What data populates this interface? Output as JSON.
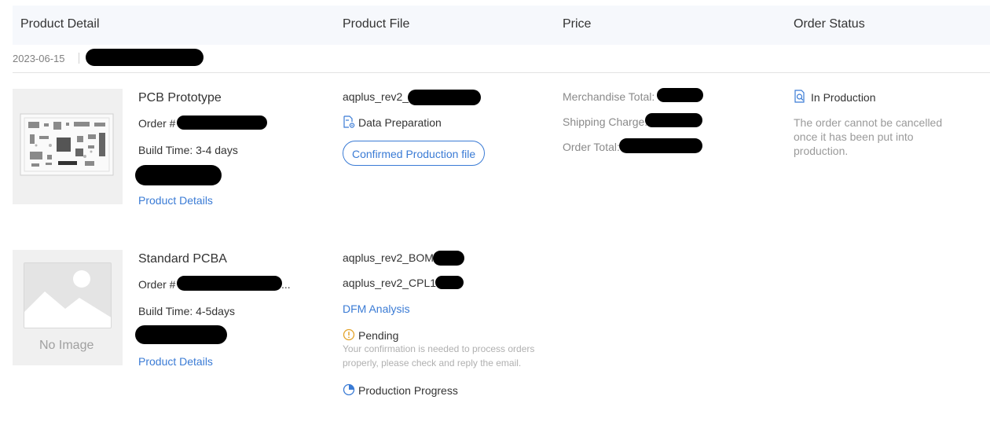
{
  "columns": {
    "product_detail": "Product Detail",
    "product_file": "Product File",
    "price": "Price",
    "order_status": "Order Status"
  },
  "order_date": "2023-06-15",
  "orders": [
    {
      "title": "PCB Prototype",
      "order_prefix": "Order #",
      "build_time": "Build Time: 3-4 days",
      "details_link": "Product Details",
      "file_name": "aqplus_rev2_",
      "file_status": "Data Preparation",
      "file_button": "Confirmed Production file",
      "price": {
        "merch_label": "Merchandise Total:",
        "ship_label": "Shipping Charge:",
        "total_label": "Order Total:"
      },
      "status": "In Production",
      "status_note": "The order cannot be cancelled once it has been put into production."
    },
    {
      "title": "Standard PCBA",
      "order_prefix": "Order #",
      "order_ellipsis": "...",
      "build_time": "Build Time: 4-5days",
      "details_link": "Product Details",
      "no_image": "No Image",
      "file_bom": "aqplus_rev2_BOM",
      "file_cpl": "aqplus_rev2_CPL1",
      "dfm_link": "DFM Analysis",
      "pending": "Pending",
      "pending_note": "Your confirmation is needed to process orders properly, please check and reply the email.",
      "progress_link": "Production Progress"
    }
  ],
  "icons": {
    "pcb_image": "pcb-board-icon",
    "data_prep": "document-gear-icon",
    "in_production": "magnifier-doc-icon",
    "pending": "exclamation-circle-icon",
    "progress": "pie-progress-icon",
    "no_image": "mountain-image-icon"
  },
  "colors": {
    "link": "#3a7bd5",
    "header_bg": "#f6f8fc",
    "pending_icon": "#e3a32a",
    "redaction": "#000000"
  }
}
